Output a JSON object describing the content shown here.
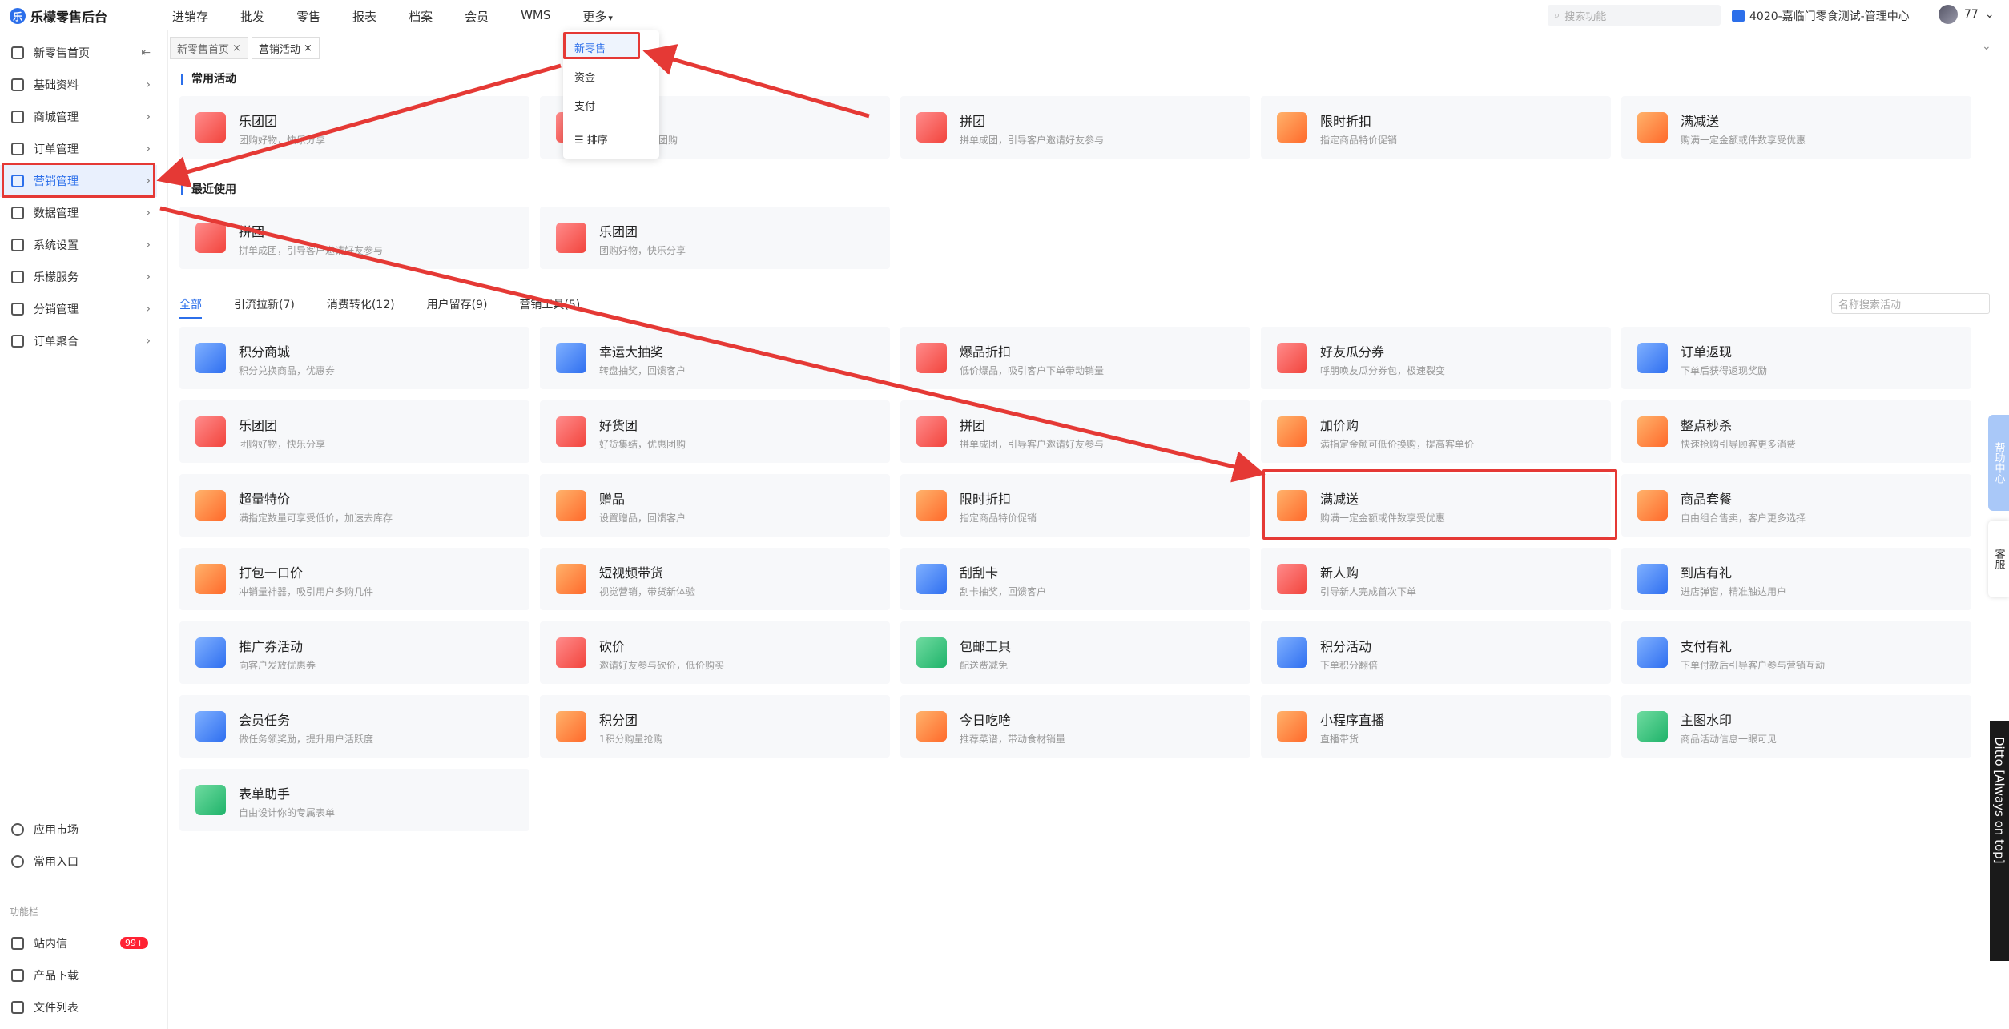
{
  "app": {
    "brand": "乐檬零售后台",
    "logo_glyph": "乐"
  },
  "topnav": [
    "进销存",
    "批发",
    "零售",
    "报表",
    "档案",
    "会员",
    "WMS",
    "更多"
  ],
  "top_search": {
    "placeholder": "搜索功能"
  },
  "store": "4020-嘉临门零食测试-管理中心",
  "user": {
    "name": "77"
  },
  "sidebar": {
    "items": [
      "新零售首页",
      "基础资料",
      "商城管理",
      "订单管理",
      "营销管理",
      "数据管理",
      "系统设置",
      "乐檬服务",
      "分销管理",
      "订单聚合"
    ],
    "active_index": 4,
    "bottom": [
      "应用市场",
      "常用入口"
    ],
    "func_label": "功能栏",
    "func_items": [
      "站内信",
      "产品下载",
      "文件列表"
    ],
    "badge": "99+"
  },
  "page_tabs": [
    {
      "label": "新零售首页"
    },
    {
      "label": "营销活动"
    }
  ],
  "dropdown": {
    "items": [
      "新零售",
      "资金",
      "支付",
      "排序"
    ]
  },
  "sections": {
    "common": "常用活动",
    "recent": "最近使用"
  },
  "common_cards": [
    {
      "title": "乐团团",
      "desc": "团购好物，快乐分享",
      "color": "red"
    },
    {
      "title": "拼团",
      "desc": "拼单成团，引导客户邀请好友参与",
      "color": "red"
    },
    {
      "title": "限时折扣",
      "desc": "指定商品特价促销",
      "color": "orange"
    },
    {
      "title": "满减送",
      "desc": "购满一定金额或件数享受优惠",
      "color": "orange"
    }
  ],
  "common_card_hidden_desc": "团购",
  "recent_cards": [
    {
      "title": "拼团",
      "desc": "拼单成团，引导客户邀请好友参与",
      "color": "red"
    },
    {
      "title": "乐团团",
      "desc": "团购好物，快乐分享",
      "color": "red"
    }
  ],
  "filter_tabs": [
    "全部",
    "引流拉新(7)",
    "消费转化(12)",
    "用户留存(9)",
    "营销工具(5)"
  ],
  "activity_search": {
    "placeholder": "名称搜索活动"
  },
  "all_cards": [
    {
      "title": "积分商城",
      "desc": "积分兑换商品，优惠券",
      "color": "blue"
    },
    {
      "title": "幸运大抽奖",
      "desc": "转盘抽奖，回馈客户",
      "color": "blue"
    },
    {
      "title": "爆品折扣",
      "desc": "低价爆品，吸引客户下单带动销量",
      "color": "red"
    },
    {
      "title": "好友瓜分券",
      "desc": "呼朋唤友瓜分券包，极速裂变",
      "color": "red"
    },
    {
      "title": "订单返现",
      "desc": "下单后获得返现奖励",
      "color": "blue"
    },
    {
      "title": "乐团团",
      "desc": "团购好物，快乐分享",
      "color": "red"
    },
    {
      "title": "好货团",
      "desc": "好货集结，优惠团购",
      "color": "red"
    },
    {
      "title": "拼团",
      "desc": "拼单成团，引导客户邀请好友参与",
      "color": "red"
    },
    {
      "title": "加价购",
      "desc": "满指定金额可低价换购，提高客单价",
      "color": "orange"
    },
    {
      "title": "整点秒杀",
      "desc": "快速抢购引导顾客更多消费",
      "color": "orange"
    },
    {
      "title": "超量特价",
      "desc": "满指定数量可享受低价，加速去库存",
      "color": "orange"
    },
    {
      "title": "赠品",
      "desc": "设置赠品，回馈客户",
      "color": "orange"
    },
    {
      "title": "限时折扣",
      "desc": "指定商品特价促销",
      "color": "orange"
    },
    {
      "title": "满减送",
      "desc": "购满一定金额或件数享受优惠",
      "color": "orange"
    },
    {
      "title": "商品套餐",
      "desc": "自由组合售卖，客户更多选择",
      "color": "orange"
    },
    {
      "title": "打包一口价",
      "desc": "冲销量神器，吸引用户多购几件",
      "color": "orange"
    },
    {
      "title": "短视频带货",
      "desc": "视觉营销，带货新体验",
      "color": "orange"
    },
    {
      "title": "刮刮卡",
      "desc": "刮卡抽奖，回馈客户",
      "color": "blue"
    },
    {
      "title": "新人购",
      "desc": "引导新人完成首次下单",
      "color": "red"
    },
    {
      "title": "到店有礼",
      "desc": "进店弹窗，精准触达用户",
      "color": "blue"
    },
    {
      "title": "推广券活动",
      "desc": "向客户发放优惠券",
      "color": "blue"
    },
    {
      "title": "砍价",
      "desc": "邀请好友参与砍价，低价购买",
      "color": "red"
    },
    {
      "title": "包邮工具",
      "desc": "配送费减免",
      "color": "green"
    },
    {
      "title": "积分活动",
      "desc": "下单积分翻倍",
      "color": "blue"
    },
    {
      "title": "支付有礼",
      "desc": "下单付款后引导客户参与营销互动",
      "color": "blue"
    },
    {
      "title": "会员任务",
      "desc": "做任务领奖励，提升用户活跃度",
      "color": "blue"
    },
    {
      "title": "积分团",
      "desc": "1积分购量抢购",
      "color": "orange"
    },
    {
      "title": "今日吃啥",
      "desc": "推荐菜谱，带动食材销量",
      "color": "orange"
    },
    {
      "title": "小程序直播",
      "desc": "直播带货",
      "color": "orange"
    },
    {
      "title": "主图水印",
      "desc": "商品活动信息一眼可见",
      "color": "green"
    },
    {
      "title": "表单助手",
      "desc": "自由设计你的专属表单",
      "color": "green"
    }
  ],
  "side_widgets": {
    "help": "帮助中心",
    "service": "客服",
    "ditto": "Ditto [Always on top]"
  },
  "colors": {
    "accent": "#2c6fea",
    "highlight": "#e53935"
  }
}
